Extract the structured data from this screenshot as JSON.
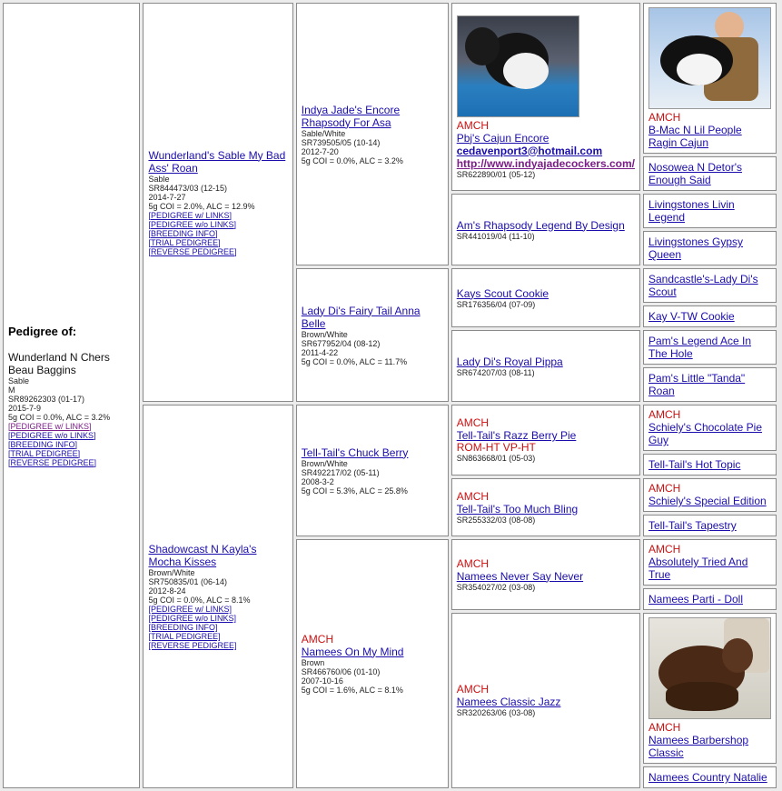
{
  "subject": {
    "header": "Pedigree of:",
    "name": "Wunderland N Chers Beau Baggins",
    "color": "Sable",
    "sex": "M",
    "reg": "SR89262303 (01-17)",
    "dob": "2015-7-9",
    "coi": "5g COI = 0.0%, ALC = 3.2%",
    "links": [
      "[PEDIGREE w/ LINKS]",
      "[PEDIGREE w/o LINKS]",
      "[BREEDING INFO]",
      "[TRIAL PEDIGREE]",
      "[REVERSE PEDIGREE]"
    ]
  },
  "sire": {
    "name": "Wunderland's Sable My Bad Ass' Roan",
    "color": "Sable",
    "reg": "SR844473/03 (12-15)",
    "dob": "2014-7-27",
    "coi": "5g COI = 2.0%, ALC = 12.9%",
    "links": [
      "[PEDIGREE w/ LINKS]",
      "[PEDIGREE w/o LINKS]",
      "[BREEDING INFO]",
      "[TRIAL PEDIGREE]",
      "[REVERSE PEDIGREE]"
    ]
  },
  "dam": {
    "name": "Shadowcast N Kayla's Mocha Kisses",
    "color": "Brown/White",
    "reg": "SR750835/01 (06-14)",
    "dob": "2012-8-24",
    "coi": "5g COI = 0.0%, ALC = 8.1%",
    "links": [
      "[PEDIGREE w/ LINKS]",
      "[PEDIGREE w/o LINKS]",
      "[BREEDING INFO]",
      "[TRIAL PEDIGREE]",
      "[REVERSE PEDIGREE]"
    ]
  },
  "gen3": {
    "ss": {
      "name": "Indya Jade's Encore Rhapsody For Asa",
      "color": "Sable/White",
      "reg": "SR739505/05 (10-14)",
      "dob": "2012-7-20",
      "coi": "5g COI = 0.0%, ALC = 3.2%"
    },
    "sd": {
      "name": "Lady Di's Fairy Tail Anna Belle",
      "color": "Brown/White",
      "reg": "SR677952/04 (08-12)",
      "dob": "2011-4-22",
      "coi": "5g COI = 0.0%, ALC = 11.7%"
    },
    "ds": {
      "name": "Tell-Tail's Chuck Berry",
      "color": "Brown/White",
      "reg": "SR492217/02 (05-11)",
      "dob": "2008-3-2",
      "coi": "5g COI = 5.3%, ALC = 25.8%"
    },
    "dd": {
      "title": "AMCH",
      "name": "Namees On My Mind",
      "color": "Brown",
      "reg": "SR466760/06 (01-10)",
      "dob": "2007-10-16",
      "coi": "5g COI = 1.6%, ALC = 8.1%"
    }
  },
  "gen4": {
    "sss": {
      "title": "AMCH",
      "name": "Pbj's Cajun Encore",
      "email": "cedavenport3@hotmail.com",
      "url": "http://www.indyajadecockers.com/",
      "reg": "SR622890/01 (05-12)"
    },
    "ssd": {
      "name": "Am's Rhapsody Legend By Design",
      "reg": "SR441019/04 (11-10)"
    },
    "sds": {
      "name": "Kays Scout Cookie",
      "reg": "SR176356/04 (07-09)"
    },
    "sdd": {
      "name": "Lady Di's Royal Pippa",
      "reg": "SR674207/03 (08-11)"
    },
    "dss": {
      "title": "AMCH",
      "name": "Tell-Tail's Razz Berry Pie",
      "subtitle": "ROM-HT VP-HT",
      "reg": "SN863668/01 (05-03)"
    },
    "dsd": {
      "title": "AMCH",
      "name": "Tell-Tail's Too Much Bling",
      "reg": "SR255332/03 (08-08)"
    },
    "dds": {
      "title": "AMCH",
      "name": "Namees Never Say Never",
      "reg": "SR354027/02 (03-08)"
    },
    "ddd": {
      "title": "AMCH",
      "name": "Namees Classic Jazz",
      "reg": "SR320263/06 (03-08)"
    }
  },
  "gen5": [
    {
      "title": "AMCH",
      "name": "B-Mac N Lil People Ragin Cajun"
    },
    {
      "name": "Nosowea N Detor's Enough Said"
    },
    {
      "name": "Livingstones Livin Legend"
    },
    {
      "name": "Livingstones Gypsy Queen"
    },
    {
      "name": "Sandcastle's-Lady Di's Scout"
    },
    {
      "name": "Kay V-TW Cookie"
    },
    {
      "name": "Pam's Legend Ace In The Hole"
    },
    {
      "name": "Pam's Little \"Tanda\" Roan"
    },
    {
      "title": "AMCH",
      "name": "Schiely's Chocolate Pie Guy"
    },
    {
      "name": "Tell-Tail's Hot Topic"
    },
    {
      "title": "AMCH",
      "name": "Schiely's Special Edition"
    },
    {
      "name": "Tell-Tail's Tapestry"
    },
    {
      "title": "AMCH",
      "name": "Absolutely Tried And True"
    },
    {
      "name": "Namees Parti - Doll"
    },
    {
      "title": "AMCH",
      "name": "Namees Barbershop Classic"
    },
    {
      "name": "Namees Country Natalie"
    }
  ],
  "colors": {
    "link": "#1a0dab",
    "visited": "#7b1d88",
    "title": "#cc1111"
  }
}
